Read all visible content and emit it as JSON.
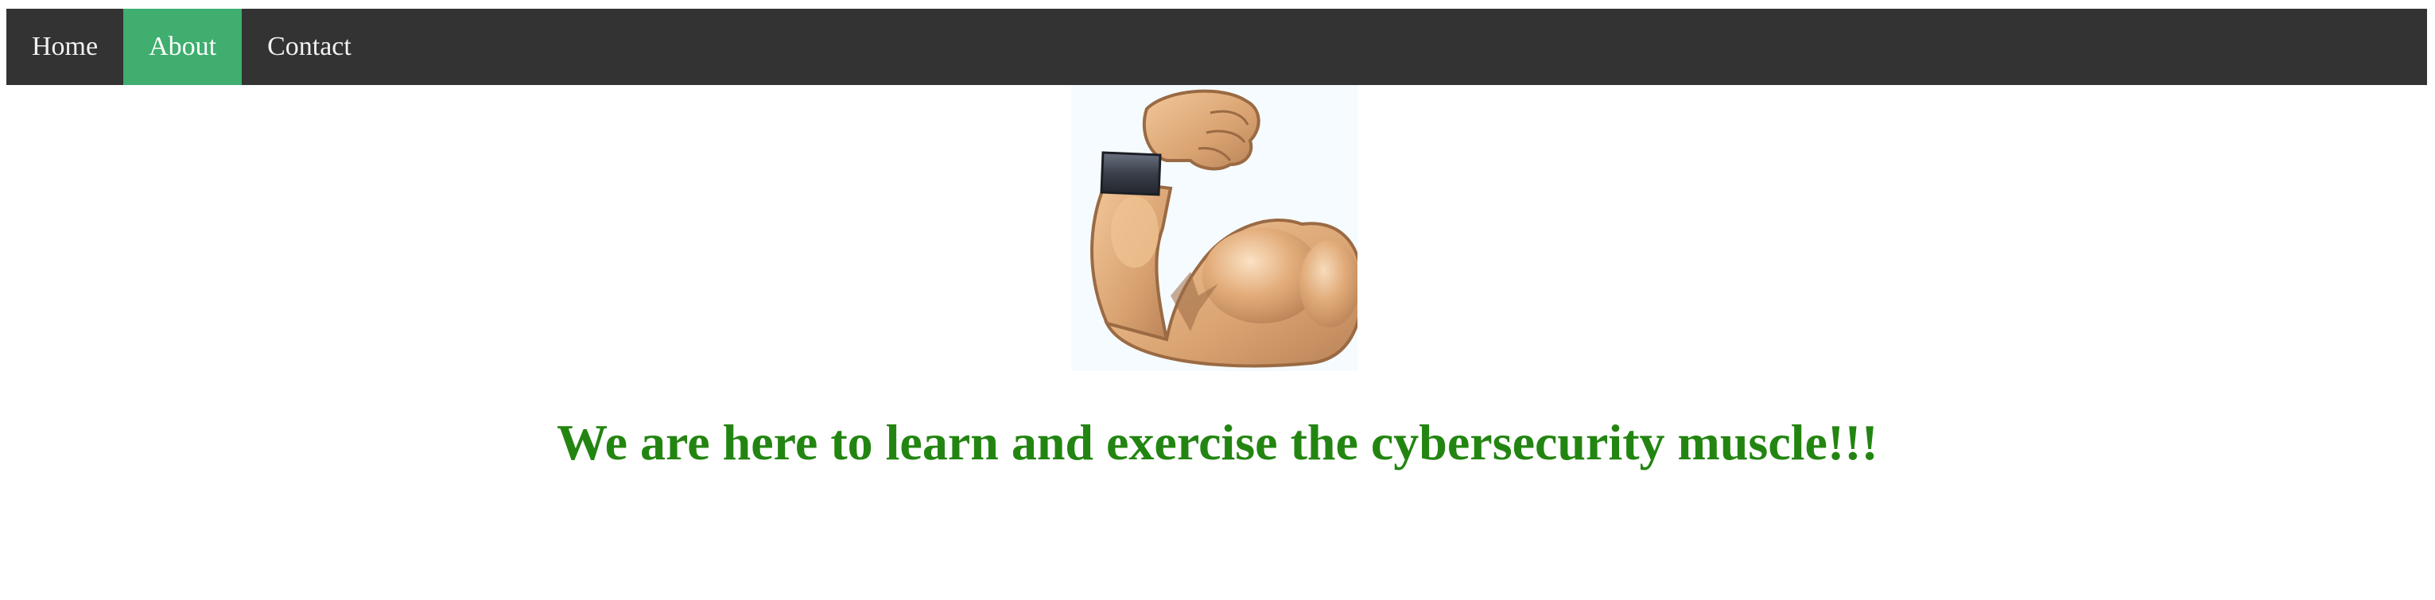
{
  "nav": {
    "items": [
      {
        "label": "Home",
        "active": false
      },
      {
        "label": "About",
        "active": true
      },
      {
        "label": "Contact",
        "active": false
      }
    ],
    "background_color": "#333333",
    "active_color": "#3fae6e"
  },
  "hero": {
    "icon": "flexed-biceps-icon"
  },
  "main": {
    "tagline": "We are here to learn and exercise the cybersecurity muscle!!!",
    "tagline_color": "#238511"
  }
}
